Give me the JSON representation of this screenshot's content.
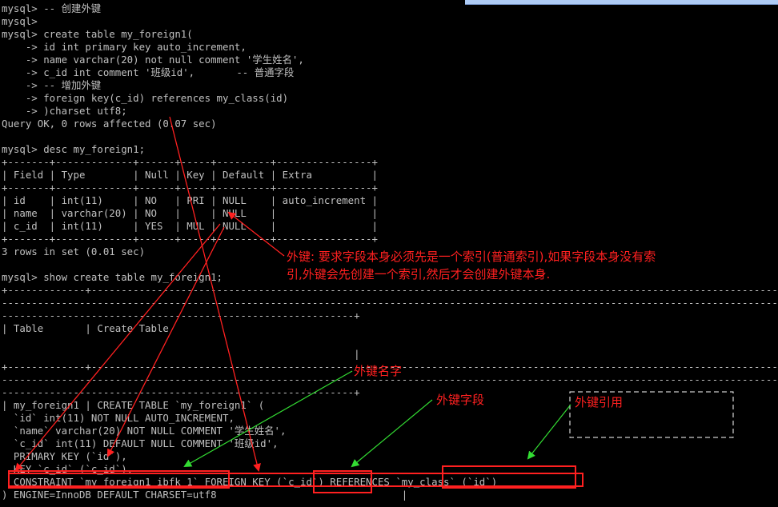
{
  "terminal": {
    "lines": [
      "mysql> -- 创建外键",
      "mysql>",
      "mysql> create table my_foreign1(",
      "    -> id int primary key auto_increment,",
      "    -> name varchar(20) not null comment '学生姓名',",
      "    -> c_id int comment '班级id',       -- 普通字段",
      "    -> -- 增加外键",
      "    -> foreign key(c_id) references my_class(id)",
      "    -> )charset utf8;",
      "Query OK, 0 rows affected (0.07 sec)",
      "",
      "mysql> desc my_foreign1;",
      "+-------+-------------+------+-----+---------+----------------+",
      "| Field | Type        | Null | Key | Default | Extra          |",
      "+-------+-------------+------+-----+---------+----------------+",
      "| id    | int(11)     | NO   | PRI | NULL    | auto_increment |",
      "| name  | varchar(20) | NO   |     | NULL    |                |",
      "| c_id  | int(11)     | YES  | MUL | NULL    |                |",
      "+-------+-------------+------+-----+---------+----------------+",
      "3 rows in set (0.01 sec)",
      "",
      "mysql> show create table my_foreign1;",
      "+-------------+-------------------------------------------------------------------------------------------------------------------------------------------------",
      "-------------------------------------------------------------------------------------------------------------------------------------------------",
      "-----------------------------------------------------------+",
      "| Table       | Create Table",
      "",
      "                                                           |",
      "+-------------+-------------------------------------------------------------------------------------------------------------------------------------------------",
      "-------------------------------------------------------------------------------------------------------------------------------------------------",
      "-----------------------------------------------------------+",
      "| my_foreign1 | CREATE TABLE `my_foreign1` (",
      "  `id` int(11) NOT NULL AUTO_INCREMENT,",
      "  `name` varchar(20) NOT NULL COMMENT '学生姓名',",
      "  `c_id` int(11) DEFAULT NULL COMMENT '班级id',",
      "  PRIMARY KEY (`id`),",
      "  KEY `c_id` (`c_id`),",
      "  CONSTRAINT `my_foreign1_ibfk_1` FOREIGN KEY (`c_id`) REFERENCES `my_class` (`id`)",
      ") ENGINE=InnoDB DEFAULT CHARSET=utf8                               |"
    ]
  },
  "annotations": {
    "note_line1": "外键: 要求字段本身必须先是一个索引(普通索引),如果字段本身没有索",
    "note_line2": "引,外键会先创建一个索引,然后才会创建外键本身.",
    "fk_name": "外键名字",
    "fk_field": "外键字段",
    "fk_reference": "外键引用"
  },
  "colors": {
    "background": "#000000",
    "text": "#c0c0c0",
    "annotation_red": "#ff2020",
    "arrow_green": "#33dd33"
  }
}
